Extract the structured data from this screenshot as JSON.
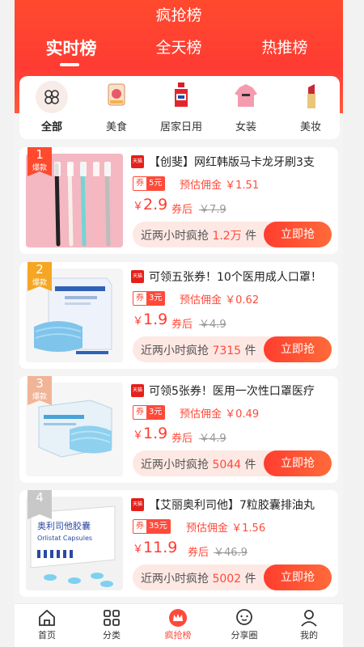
{
  "header": {
    "title": "疯抢榜",
    "tabs": [
      {
        "label": "实时榜",
        "active": true
      },
      {
        "label": "全天榜",
        "active": false
      },
      {
        "label": "热推榜",
        "active": false
      }
    ]
  },
  "categories": [
    {
      "label": "全部",
      "icon": "grid-icon",
      "selected": true
    },
    {
      "label": "美食",
      "icon": "snack-icon",
      "selected": false
    },
    {
      "label": "居家日用",
      "icon": "detergent-bottle-icon",
      "selected": false
    },
    {
      "label": "女装",
      "icon": "pink-hoodie-icon",
      "selected": false
    },
    {
      "label": "美妆",
      "icon": "lipstick-icon",
      "selected": false
    }
  ],
  "common": {
    "coupon_label": "券",
    "commission_label": "预估佣金",
    "after_coupon": "券后",
    "currency": "￥",
    "grab_button": "立即抢",
    "hot_tag": "爆款",
    "platform_badge": "天猫"
  },
  "products": [
    {
      "rank": "1",
      "title": "【创斐】网红韩版马卡龙牙刷3支",
      "coupon": "5元",
      "commission": "￥1.51",
      "price": "2.9",
      "original": "￥7.9",
      "sales_prefix": "近两小时疯抢",
      "sales": "1.2万",
      "sales_suffix": "件",
      "thumb": "toothbrushes"
    },
    {
      "rank": "2",
      "title": "可领五张券！10个医用成人口罩！",
      "coupon": "3元",
      "commission": "￥0.62",
      "price": "1.9",
      "original": "￥4.9",
      "sales_prefix": "近两小时疯抢",
      "sales": "7315",
      "sales_suffix": "件",
      "thumb": "mask-bag"
    },
    {
      "rank": "3",
      "title": "可领5张券！医用一次性口罩医疗",
      "coupon": "3元",
      "commission": "￥0.49",
      "price": "1.9",
      "original": "￥4.9",
      "sales_prefix": "近两小时疯抢",
      "sales": "5044",
      "sales_suffix": "件",
      "thumb": "mask-box"
    },
    {
      "rank": "4",
      "title": "【艾丽奥利司他】7粒胶囊排油丸",
      "coupon": "35元",
      "commission": "￥1.56",
      "price": "11.9",
      "original": "￥46.9",
      "sales_prefix": "近两小时疯抢",
      "sales": "5002",
      "sales_suffix": "件",
      "thumb": "capsule-box",
      "box_text": "奥利司他胶囊",
      "box_text_en": "Orlistat Capsules"
    }
  ],
  "rank_colors": [
    "#ff4a2e",
    "#f5a623",
    "#f0b497",
    "#c8c8c8"
  ],
  "nav": [
    {
      "label": "首页",
      "icon": "home-icon",
      "selected": false
    },
    {
      "label": "分类",
      "icon": "category-grid-icon",
      "selected": false
    },
    {
      "label": "疯抢榜",
      "icon": "crown-icon",
      "selected": true
    },
    {
      "label": "分享圈",
      "icon": "chat-bubble-icon",
      "selected": false
    },
    {
      "label": "我的",
      "icon": "user-icon",
      "selected": false
    }
  ]
}
